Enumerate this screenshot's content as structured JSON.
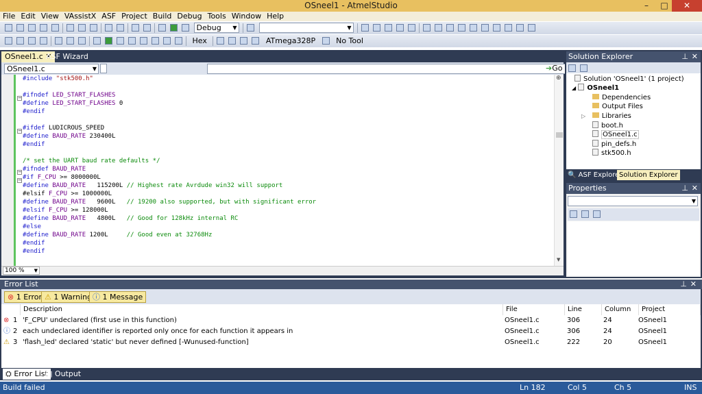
{
  "window": {
    "title": "OSneel1 - AtmelStudio",
    "min": "–",
    "max": "□",
    "close": "✕"
  },
  "menu": [
    "File",
    "Edit",
    "View",
    "VAssistX",
    "ASF",
    "Project",
    "Build",
    "Debug",
    "Tools",
    "Window",
    "Help"
  ],
  "toolbar": {
    "config": "Debug",
    "device": "ATmega328P",
    "tool": "No Tool",
    "hex": "Hex"
  },
  "tabs": {
    "active": "OSneel1.c",
    "asf": "ASF Wizard"
  },
  "nav": {
    "file": "OSneel1.c",
    "go": "Go"
  },
  "code_lines": [
    "#include \"stk500.h\"",
    "",
    "#ifndef LED_START_FLASHES",
    "#define LED_START_FLASHES 0",
    "#endif",
    "",
    "#ifdef LUDICROUS_SPEED",
    "#define BAUD_RATE 230400L",
    "#endif",
    "",
    "/* set the UART baud rate defaults */",
    "#ifndef BAUD_RATE",
    "#if F_CPU >= 8000000L",
    "#define BAUD_RATE   115200L // Highest rate Avrdude win32 will support",
    "#elsif F_CPU >= 1000000L",
    "#define BAUD_RATE   9600L   // 19200 also supported, but with significant error",
    "#elsif F_CPU >= 128000L",
    "#define BAUD_RATE   4800L   // Good for 128kHz internal RC",
    "#else",
    "#define BAUD_RATE 1200L     // Good even at 32768Hz",
    "#endif",
    "#endif"
  ],
  "zoom": "100 %",
  "solution_explorer": {
    "title": "Solution Explorer",
    "solution": "Solution 'OSneel1' (1 project)",
    "project": "OSneel1",
    "items": [
      "Dependencies",
      "Output Files",
      "Libraries",
      "boot.h",
      "OSneel1.c",
      "pin_defs.h",
      "stk500.h"
    ],
    "tab_asf": "ASF Explorer",
    "tab_se": "Solution Explorer"
  },
  "properties": {
    "title": "Properties"
  },
  "error_list": {
    "title": "Error List",
    "filters": {
      "errors": "1 Error",
      "warnings": "1 Warning",
      "messages": "1 Message"
    },
    "columns": {
      "description": "Description",
      "file": "File",
      "line": "Line",
      "column": "Column",
      "project": "Project"
    },
    "rows": [
      {
        "num": "1",
        "desc": "'F_CPU' undeclared (first use in this function)",
        "file": "OSneel1.c",
        "line": "306",
        "col": "24",
        "proj": "OSneel1"
      },
      {
        "num": "2",
        "desc": "each undeclared identifier is reported only once for each function it appears in",
        "file": "OSneel1.c",
        "line": "306",
        "col": "24",
        "proj": "OSneel1"
      },
      {
        "num": "3",
        "desc": "'flash_led' declared 'static' but never defined [-Wunused-function]",
        "file": "OSneel1.c",
        "line": "222",
        "col": "20",
        "proj": "OSneel1"
      }
    ]
  },
  "bottom_tabs": {
    "errors": "Error List",
    "output": "Output"
  },
  "status": {
    "msg": "Build failed",
    "ln": "Ln 182",
    "col": "Col 5",
    "ch": "Ch 5",
    "mode": "INS"
  }
}
